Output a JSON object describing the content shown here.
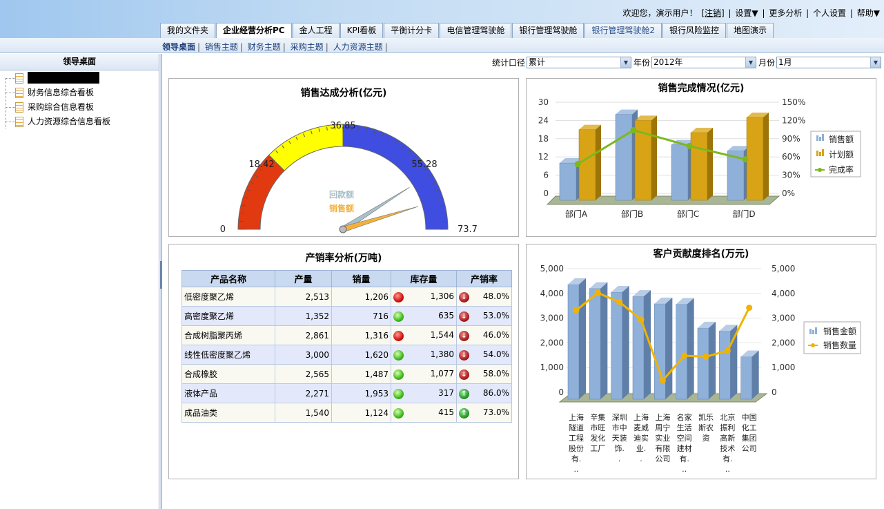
{
  "header": {
    "welcome": "欢迎您，演示用户！",
    "logout": "[注销]",
    "sep": "|",
    "settings": "设置▼",
    "more": "更多分析",
    "profile": "个人设置",
    "help": "帮助▼"
  },
  "tabs": [
    "我的文件夹",
    "企业经营分析PC",
    "金人工程",
    "KPI看板",
    "平衡计分卡",
    "电信管理驾驶舱",
    "银行管理驾驶舱",
    "银行管理驾驶舱2",
    "银行风险监控",
    "地图演示"
  ],
  "subnav": [
    "领导桌面",
    "销售主题",
    "财务主题",
    "采购主题",
    "人力资源主题"
  ],
  "sidebar": {
    "title": "领导桌面",
    "items": [
      "",
      "财务信息综合看板",
      "采购综合信息看板",
      "人力资源综合信息看板"
    ]
  },
  "filters": {
    "label1": "统计口径",
    "value1": "累计",
    "label2": "年份",
    "value2": "2012年",
    "label3": "月份",
    "value3": "1月"
  },
  "gauge": {
    "title": "销售达成分析(亿元)",
    "ticks": [
      "0",
      "18.42",
      "36.85",
      "55.28",
      "73.7"
    ],
    "min": 0,
    "max": 73.7,
    "bands": [
      {
        "to": 18.42,
        "color": "#e23a10"
      },
      {
        "to": 36.85,
        "color": "#ffff00"
      },
      {
        "to": 73.7,
        "color": "#3f4de0"
      }
    ],
    "needles": [
      {
        "name": "回款额",
        "value": 60.5,
        "color": "#a9c0c8"
      },
      {
        "name": "销售额",
        "value": 66.8,
        "color": "#f3b13c"
      }
    ]
  },
  "chart_data": [
    {
      "type": "bar",
      "title": "销售完成情况(亿元)",
      "categories": [
        "部门A",
        "部门B",
        "部门C",
        "部门D"
      ],
      "series": [
        {
          "name": "销售额",
          "values": [
            10,
            26,
            16,
            14
          ],
          "axis": "left"
        },
        {
          "name": "计划额",
          "values": [
            21,
            24,
            20,
            25
          ],
          "axis": "left"
        },
        {
          "name": "完成率",
          "values": [
            48,
            104,
            78,
            56
          ],
          "axis": "right",
          "type": "line"
        }
      ],
      "ylim": [
        0,
        30
      ],
      "yticks": [
        "30",
        "24",
        "18",
        "12",
        "6",
        "0"
      ],
      "y2lim": [
        0,
        150
      ],
      "y2ticks": [
        "150%",
        "120%",
        "90%",
        "60%",
        "30%",
        "0%"
      ],
      "colors": {
        "sales": "#8fb0d8",
        "plan": "#d8a416",
        "rate": "#7cb81c"
      }
    },
    {
      "type": "bar",
      "title": "客户贡献度排名(万元)",
      "categories": [
        "上海隧道工程股份有...",
        "辛集市旺发化工厂",
        "深圳市中天装饰..",
        "上海麦威迪实业..",
        "上海周宁实业有限公司",
        "名家生活空间建材有...",
        "凯乐斯农资",
        "北京振利高新技术有...",
        "中国化工集团公司"
      ],
      "series": [
        {
          "name": "销售金额",
          "values": [
            4360,
            4200,
            4050,
            3880,
            3580,
            3560,
            2600,
            2480,
            1440
          ],
          "axis": "left"
        },
        {
          "name": "销售数量",
          "values": [
            3320,
            4020,
            3650,
            2940,
            480,
            1480,
            1440,
            1680,
            3420
          ],
          "axis": "right",
          "type": "line"
        }
      ],
      "ylim": [
        0,
        5000
      ],
      "yticks": [
        "5,000",
        "4,000",
        "3,000",
        "2,000",
        "1,000",
        "0"
      ],
      "y2ticks": [
        "5,000",
        "4,000",
        "3,000",
        "2,000",
        "1,000",
        "0"
      ],
      "colors": {
        "amount": "#8fb0d8",
        "qty": "#f0b400"
      }
    }
  ],
  "table": {
    "title": "产销率分析(万吨)",
    "headers": [
      "产品名称",
      "产量",
      "销量",
      "库存量",
      "产销率"
    ],
    "rows": [
      {
        "name": "低密度聚乙烯",
        "prod": "2,513",
        "sales": "1,206",
        "stock_status": "red",
        "stock": "1,306",
        "trend": "down",
        "rate": "48.0%"
      },
      {
        "name": "高密度聚乙烯",
        "prod": "1,352",
        "sales": "716",
        "stock_status": "green",
        "stock": "635",
        "trend": "down",
        "rate": "53.0%"
      },
      {
        "name": "合成树脂聚丙烯",
        "prod": "2,861",
        "sales": "1,316",
        "stock_status": "red",
        "stock": "1,544",
        "trend": "down",
        "rate": "46.0%"
      },
      {
        "name": "线性低密度聚乙烯",
        "prod": "3,000",
        "sales": "1,620",
        "stock_status": "green",
        "stock": "1,380",
        "trend": "down",
        "rate": "54.0%"
      },
      {
        "name": "合成橡胶",
        "prod": "2,565",
        "sales": "1,487",
        "stock_status": "green",
        "stock": "1,077",
        "trend": "down",
        "rate": "58.0%"
      },
      {
        "name": "液体产品",
        "prod": "2,271",
        "sales": "1,953",
        "stock_status": "green",
        "stock": "317",
        "trend": "up",
        "rate": "86.0%"
      },
      {
        "name": "成品油类",
        "prod": "1,540",
        "sales": "1,124",
        "stock_status": "green",
        "stock": "415",
        "trend": "up",
        "rate": "73.0%"
      }
    ]
  }
}
